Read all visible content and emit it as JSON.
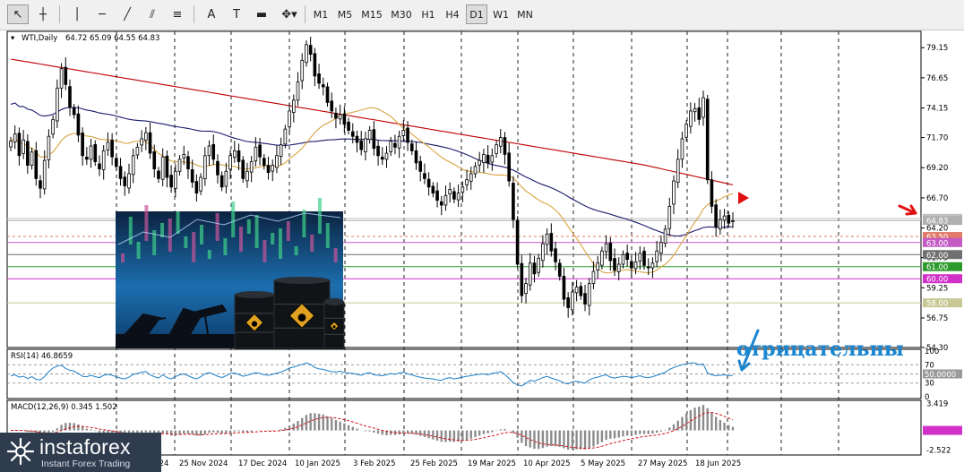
{
  "toolbar": {
    "tools": [
      {
        "name": "cursor-tool",
        "icon": "arrow-cursor-icon",
        "glyph": "↖"
      },
      {
        "name": "crosshair-tool",
        "icon": "crosshair-icon",
        "glyph": "┼"
      },
      {
        "name": "vertical-line-tool",
        "icon": "vertical-line-icon",
        "glyph": "│"
      },
      {
        "name": "horizontal-line-tool",
        "icon": "horizontal-line-icon",
        "glyph": "─"
      },
      {
        "name": "trendline-tool",
        "icon": "trendline-icon",
        "glyph": "╱"
      },
      {
        "name": "channel-tool",
        "icon": "channel-icon",
        "glyph": "⫽"
      },
      {
        "name": "fibonacci-tool",
        "icon": "fibonacci-icon",
        "glyph": "≡"
      },
      {
        "name": "text-tool",
        "icon": "text-icon",
        "glyph": "A"
      },
      {
        "name": "text-label-tool",
        "icon": "text-label-icon",
        "glyph": "T"
      },
      {
        "name": "rectangle-tool",
        "icon": "rectangle-icon",
        "glyph": "▬"
      },
      {
        "name": "shapes-tool",
        "icon": "shapes-icon",
        "glyph": "✥▾"
      }
    ],
    "timeframes": [
      "M1",
      "M5",
      "M15",
      "M30",
      "H1",
      "H4",
      "D1",
      "W1",
      "MN"
    ],
    "active_timeframe": "D1"
  },
  "chart_data": {
    "type": "candlestick",
    "title": "WTI,Daily",
    "ohlc_header": "64.72 65.09 64.55 64.83",
    "x_labels": [
      "11 Nov 2024",
      "25 Nov 2024",
      "17 Dec 2024",
      "10 Jan 2025",
      "3 Feb 2025",
      "25 Feb 2025",
      "19 Mar 2025",
      "10 Apr 2025",
      "5 May 2025",
      "27 May 2025",
      "18 Jun 2025"
    ],
    "price_axis_labels": [
      "79.15",
      "76.65",
      "74.15",
      "71.70",
      "69.20",
      "66.70",
      "64.20",
      "61.75",
      "59.25",
      "56.75",
      "54.30"
    ],
    "ylim": [
      54.3,
      80.5
    ],
    "price_badges": [
      {
        "value": "65.00",
        "color": "#c0c0c0"
      },
      {
        "value": "64.83",
        "color": "#b0b0b0"
      },
      {
        "value": "63.50",
        "color": "#e07a6a"
      },
      {
        "value": "63.00",
        "color": "#c45ac4"
      },
      {
        "value": "62.00",
        "color": "#707070"
      },
      {
        "value": "61.00",
        "color": "#2e9a2e"
      },
      {
        "value": "60.00",
        "color": "#d030c8"
      },
      {
        "value": "58.00",
        "color": "#c8c896"
      }
    ],
    "horizontal_levels": [
      {
        "price": 65.0,
        "color": "#c8c8c8"
      },
      {
        "price": 64.83,
        "color": "#a8a8a8"
      },
      {
        "price": 63.5,
        "color": "#e07a6a"
      },
      {
        "price": 63.0,
        "color": "#c45ac4"
      },
      {
        "price": 62.0,
        "color": "#707070"
      },
      {
        "price": 61.0,
        "color": "#2e9a2e"
      },
      {
        "price": 60.0,
        "color": "#d030c8"
      },
      {
        "price": 58.0,
        "color": "#c8c896"
      }
    ],
    "ma_colors": {
      "ma200": "#c00000",
      "ma100": "#1a1a6e",
      "ma50": "#d9a441"
    },
    "closes": [
      71.4,
      72.0,
      70.2,
      71.5,
      69.4,
      70.5,
      68.3,
      67.5,
      69.8,
      71.8,
      73.2,
      75.8,
      77.4,
      76.1,
      74.2,
      73.6,
      71.9,
      70.2,
      69.9,
      71.0,
      69.7,
      69.1,
      70.6,
      71.3,
      70.1,
      69.3,
      68.3,
      67.7,
      68.7,
      70.2,
      70.9,
      71.6,
      72.1,
      70.4,
      69.1,
      68.3,
      70.1,
      68.4,
      67.6,
      68.9,
      69.9,
      70.3,
      69.1,
      68.0,
      67.1,
      68.4,
      70.2,
      71.0,
      69.9,
      68.6,
      67.6,
      68.9,
      70.2,
      70.6,
      69.7,
      68.3,
      68.9,
      69.7,
      70.9,
      70.1,
      69.4,
      68.8,
      69.4,
      70.2,
      71.1,
      72.4,
      73.9,
      74.8,
      76.3,
      78.1,
      79.4,
      78.6,
      76.8,
      76.2,
      75.9,
      74.6,
      73.9,
      73.3,
      73.6,
      72.8,
      72.3,
      71.8,
      71.3,
      70.7,
      71.6,
      72.3,
      70.8,
      70.2,
      69.9,
      70.4,
      71.4,
      70.9,
      71.8,
      72.3,
      71.3,
      70.6,
      69.6,
      68.9,
      68.3,
      67.6,
      67.1,
      66.5,
      66.1,
      66.9,
      67.4,
      66.6,
      67.1,
      67.6,
      68.2,
      68.7,
      69.3,
      69.8,
      70.3,
      69.6,
      70.2,
      71.1,
      71.7,
      70.3,
      68.1,
      64.9,
      61.2,
      58.6,
      59.6,
      61.3,
      60.4,
      61.7,
      62.9,
      63.7,
      62.3,
      61.4,
      60.2,
      58.3,
      57.6,
      58.9,
      59.3,
      58.6,
      57.9,
      59.6,
      60.6,
      61.3,
      62.3,
      62.9,
      61.5,
      60.7,
      61.2,
      62.0,
      61.6,
      60.9,
      61.4,
      62.1,
      61.1,
      60.9,
      61.3,
      62.3,
      63.0,
      64.1,
      66.0,
      68.1,
      69.9,
      71.6,
      72.8,
      73.9,
      74.1,
      73.2,
      75.0,
      68.2,
      66.0,
      64.3,
      64.9,
      65.2,
      64.6,
      64.8
    ],
    "rsi": {
      "label": "RSI(14) 46.8659",
      "levels": [
        100,
        70,
        50,
        30,
        0
      ],
      "level_badge": "50.0000",
      "values": [
        46,
        48,
        43,
        45,
        40,
        44,
        38,
        37,
        44,
        55,
        63,
        67,
        69,
        62,
        58,
        56,
        51,
        45,
        44,
        47,
        44,
        42,
        47,
        49,
        47,
        44,
        41,
        39,
        43,
        49,
        51,
        54,
        55,
        48,
        44,
        41,
        48,
        42,
        39,
        44,
        48,
        50,
        46,
        42,
        39,
        44,
        50,
        53,
        49,
        45,
        42,
        46,
        51,
        52,
        49,
        45,
        47,
        50,
        53,
        51,
        48,
        47,
        49,
        52,
        54,
        58,
        63,
        65,
        68,
        71,
        74,
        71,
        64,
        61,
        60,
        57,
        55,
        54,
        56,
        53,
        52,
        51,
        49,
        47,
        51,
        53,
        48,
        47,
        46,
        48,
        51,
        49,
        52,
        54,
        50,
        48,
        45,
        43,
        41,
        40,
        39,
        37,
        36,
        40,
        42,
        39,
        41,
        43,
        45,
        46,
        48,
        49,
        50,
        48,
        51,
        53,
        55,
        49,
        40,
        31,
        26,
        24,
        29,
        36,
        34,
        38,
        42,
        45,
        41,
        38,
        35,
        30,
        28,
        33,
        34,
        32,
        30,
        37,
        41,
        43,
        46,
        48,
        43,
        41,
        43,
        45,
        44,
        42,
        44,
        46,
        43,
        42,
        44,
        47,
        50,
        54,
        60,
        64,
        67,
        70,
        72,
        74,
        74,
        70,
        72,
        52,
        48,
        46,
        47,
        48,
        46,
        47
      ]
    },
    "macd": {
      "label": "MACD(12,26,9) 0.345 1.502",
      "axis_labels": [
        "3.419",
        "0.000",
        "-2.522"
      ],
      "ylim": [
        -2.9,
        3.6
      ]
    }
  },
  "annotation": {
    "text": "отрицательны",
    "color": "#1a86d0"
  },
  "logo": {
    "brand": "instaforex",
    "tagline": "Instant Forex Trading"
  }
}
